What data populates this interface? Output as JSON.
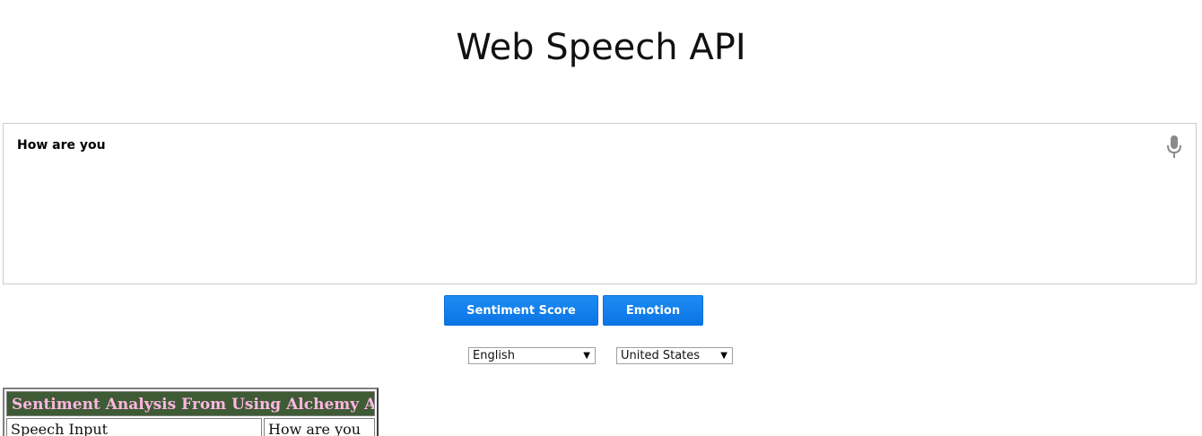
{
  "header": {
    "title": "Web Speech API"
  },
  "results": {
    "final_text": "How are you",
    "mic_icon": "microphone-icon"
  },
  "buttons": {
    "sentiment_label": "Sentiment Score",
    "emotion_label": "Emotion"
  },
  "language": {
    "selected": "English"
  },
  "dialect": {
    "selected": "United States"
  },
  "analysis_table": {
    "header": "Sentiment Analysis From Using Alchemy API",
    "rows": [
      {
        "label": "Speech Input",
        "value": "How are you"
      }
    ]
  },
  "colors": {
    "button_blue": "#0b74e6",
    "table_header_bg": "#3e5b35",
    "table_header_text": "#ffb6e1"
  }
}
